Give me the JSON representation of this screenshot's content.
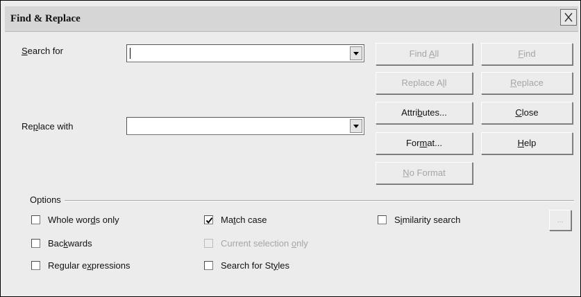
{
  "window": {
    "title": "Find & Replace"
  },
  "search": {
    "label": "Search for",
    "value": ""
  },
  "replace": {
    "label": "Replace with",
    "value": ""
  },
  "buttons": {
    "find_all": "Find All",
    "find": "Find",
    "replace_all": "Replace All",
    "replace": "Replace",
    "attributes": "Attributes...",
    "close": "Close",
    "format": "Format...",
    "help": "Help",
    "no_format": "No Format",
    "more": "..."
  },
  "options": {
    "label": "Options",
    "whole_words": {
      "label": "Whole words only",
      "checked": false
    },
    "match_case": {
      "label": "Match case",
      "checked": true
    },
    "similarity": {
      "label": "Similarity search",
      "checked": false
    },
    "backwards": {
      "label": "Backwards",
      "checked": false
    },
    "current_selection": {
      "label": "Current selection only",
      "checked": false,
      "enabled": false
    },
    "regex": {
      "label": "Regular expressions",
      "checked": false
    },
    "styles": {
      "label": "Search for Styles",
      "checked": false
    }
  }
}
